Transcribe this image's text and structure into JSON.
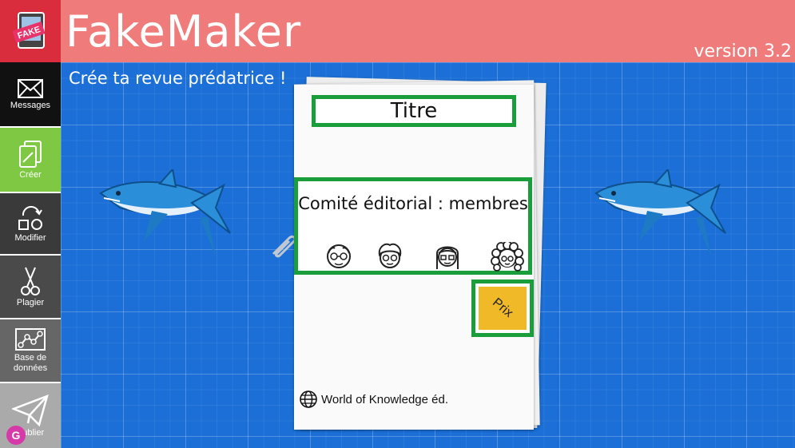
{
  "header": {
    "title": "FakeMaker",
    "version": "version 3.2",
    "logo_badge": "FAKE"
  },
  "subtitle": "Crée ta revue prédatrice !",
  "sidebar": {
    "items": [
      {
        "label": "Messages",
        "icon": "envelope-icon"
      },
      {
        "label": "Créer",
        "icon": "documents-icon"
      },
      {
        "label": "Modifier",
        "icon": "shapes-icon"
      },
      {
        "label": "Plagier",
        "icon": "scissors-icon"
      },
      {
        "label": "Base de données",
        "icon": "network-icon"
      },
      {
        "label": "Publier",
        "icon": "paper-plane-icon"
      }
    ]
  },
  "journal": {
    "title_label": "Titre",
    "committee_label": "Comité éditorial : membres",
    "price_label": "Prix",
    "publisher": "World of Knowledge éd."
  },
  "badge": "G",
  "colors": {
    "header": "#ef7b7b",
    "accent_green": "#1a9e3c",
    "sidebar_active": "#7ec843",
    "blueprint": "#1b6fd6",
    "price": "#efb928"
  }
}
